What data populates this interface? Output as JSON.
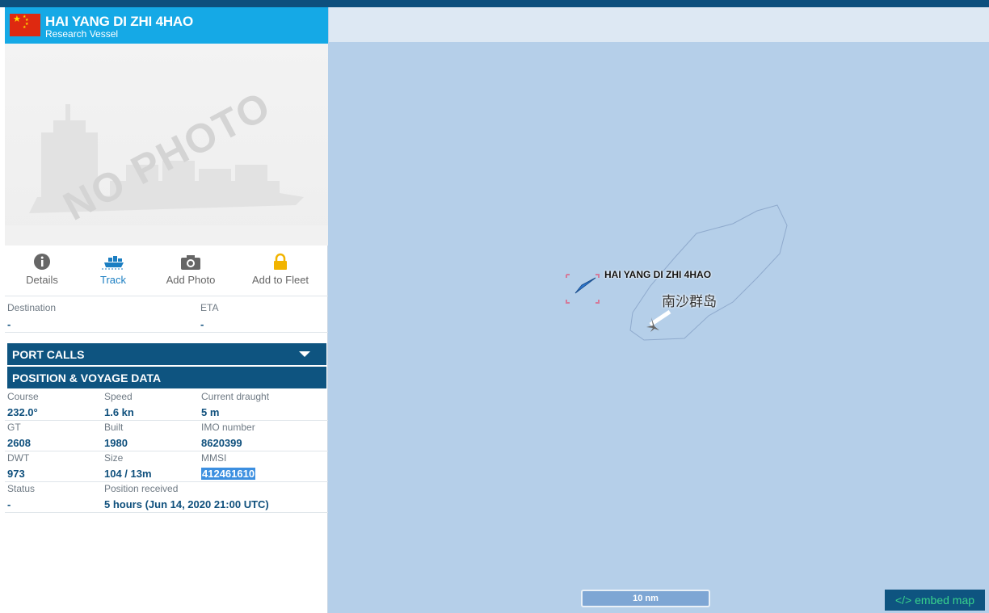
{
  "vessel": {
    "name": "HAI YANG DI ZHI 4HAO",
    "type": "Research Vessel",
    "flag": "China"
  },
  "photo": {
    "placeholder_text": "NO PHOTO"
  },
  "actions": [
    {
      "label": "Details",
      "icon": "info-icon",
      "active": false
    },
    {
      "label": "Track",
      "icon": "ship-track-icon",
      "active": true
    },
    {
      "label": "Add Photo",
      "icon": "camera-icon",
      "active": false
    },
    {
      "label": "Add to Fleet",
      "icon": "lock-icon",
      "active": false
    }
  ],
  "voyage": {
    "destination_label": "Destination",
    "destination_value": "-",
    "eta_label": "ETA",
    "eta_value": "-"
  },
  "sections": {
    "port_calls": "PORT CALLS",
    "position_voyage": "POSITION & VOYAGE DATA"
  },
  "data": {
    "course_label": "Course",
    "course_value": "232.0°",
    "speed_label": "Speed",
    "speed_value": "1.6 kn",
    "draught_label": "Current draught",
    "draught_value": "5 m",
    "gt_label": "GT",
    "gt_value": "2608",
    "built_label": "Built",
    "built_value": "1980",
    "imo_label": "IMO number",
    "imo_value": "8620399",
    "dwt_label": "DWT",
    "dwt_value": "973",
    "size_label": "Size",
    "size_value": "104 / 13m",
    "mmsi_label": "MMSI",
    "mmsi_value": "412461610",
    "status_label": "Status",
    "status_value": "-",
    "position_label": "Position received",
    "position_value": "5 hours (Jun 14, 2020 21:00 UTC)"
  },
  "map": {
    "ship_label": "HAI YANG DI ZHI 4HAO",
    "island_label": "南沙群岛",
    "scale_label": "10 nm",
    "embed_label": "</> embed map"
  },
  "colors": {
    "header": "#15a9e6",
    "section": "#0e5480",
    "value_text": "#0e4f7c",
    "map_water": "#b5cfe9",
    "embed_text": "#38d38c"
  }
}
